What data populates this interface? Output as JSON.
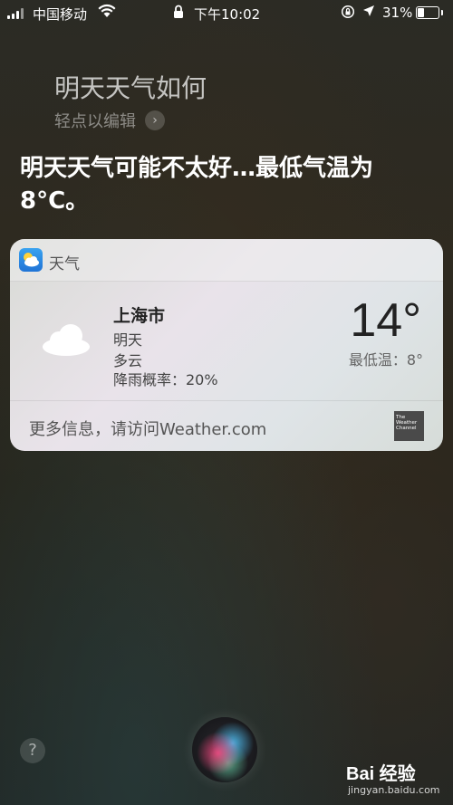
{
  "status_bar": {
    "carrier": "中国移动",
    "time": "下午10:02",
    "battery": "31%",
    "icons": [
      "signal-icon",
      "wifi-icon",
      "lock-icon",
      "rotation-lock-icon",
      "location-icon",
      "battery-icon"
    ]
  },
  "siri": {
    "query": "明天天气如何",
    "tap_to_edit": "轻点以编辑",
    "answer": "明天天气可能不太好…最低气温为8°C。"
  },
  "weather_card": {
    "app_name": "天气",
    "city": "上海市",
    "day": "明天",
    "condition": "多云",
    "rain_chance": "降雨概率：20%",
    "temperature": "14°",
    "low_temp": "最低温：8°",
    "more_info": "更多信息，请访问Weather.com",
    "provider_logo_text": "The Weather Channel"
  },
  "bottom": {
    "help": "?",
    "watermark": "Bai 经验",
    "watermark_url": "jingyan.baidu.com"
  },
  "colors": {
    "card_bg": "#e2e2e2",
    "weather_icon": "#2a8ee6"
  }
}
